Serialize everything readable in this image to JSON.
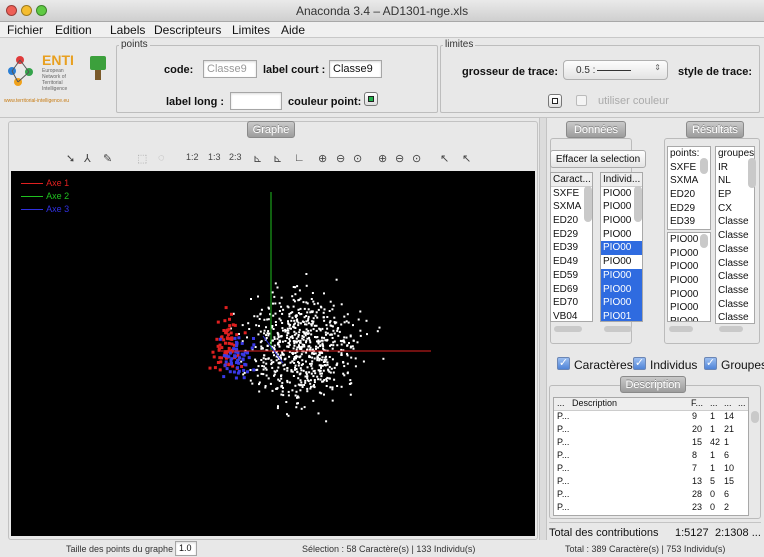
{
  "window": {
    "title": "Anaconda 3.4 – AD1301-nge.xls"
  },
  "menu": [
    "Fichier",
    "Edition",
    "Labels",
    "Descripteurs",
    "Limites",
    "Aide"
  ],
  "logo": {
    "name": "ENTI",
    "lines": [
      "European",
      "Network of",
      "Territorial",
      "Intelligence"
    ],
    "url": "www.territorial-intelligence.eu"
  },
  "points": {
    "legend": "points",
    "code_label": "code:",
    "code_value": "Classe9",
    "short_label": "label court :",
    "short_value": "Classe9",
    "long_label": "label long :",
    "long_value": "",
    "color_label": "couleur point:",
    "color_swatch": "#22b14c"
  },
  "limites": {
    "legend": "limites",
    "thickness_label": "grosseur de trace:",
    "thickness_value": "0.5 :",
    "style_label": "style de trace:",
    "use_color_label": "utiliser couleur"
  },
  "graph": {
    "tab": "Graphe",
    "tools": [
      "1:2",
      "1:3",
      "2:3"
    ],
    "axes": [
      {
        "label": "Axe 1",
        "color": "#e02020"
      },
      {
        "label": "Axe 2",
        "color": "#20c020"
      },
      {
        "label": "Axe 3",
        "color": "#3030e0"
      }
    ]
  },
  "donnees": {
    "tab": "Données",
    "clear_button": "Effacer la selection",
    "caract_header": "Caract...",
    "caract": [
      "SXFE",
      "SXMA",
      "ED20",
      "ED29",
      "ED39",
      "ED49",
      "ED59",
      "ED69",
      "ED70",
      "VB04",
      "VB09"
    ],
    "indiv_header": "Individ...",
    "indiv": [
      "PIO00",
      "PIO00",
      "PIO00",
      "PIO00",
      "PIO00",
      "PIO00",
      "PIO00",
      "PIO00",
      "PIO00",
      "PIO01",
      "PIO01"
    ],
    "indiv_selected": [
      4,
      6,
      7,
      8,
      9
    ]
  },
  "resultats": {
    "tab": "Résultats",
    "points_header": "points:",
    "points": [
      "SXFE",
      "SXMA",
      "ED20",
      "ED29",
      "ED39"
    ],
    "groups_header": "groupes",
    "groups": [
      "IR",
      "NL",
      "EP",
      "CX",
      "Classe",
      "Classe",
      "Classe",
      "Classe",
      "Classe",
      "Classe",
      "Classe",
      "Classe",
      "Classe"
    ],
    "points2": [
      "PIO00",
      "PIO00",
      "PIO00",
      "PIO00",
      "PIO00",
      "PIO00",
      "PIO00"
    ]
  },
  "checks": {
    "caracteres": "Caractères",
    "individus": "Individus",
    "groupes": "Groupes"
  },
  "description": {
    "tab": "Description",
    "headers": [
      "...",
      "Description",
      "F...",
      "...",
      "...",
      "..."
    ],
    "rows": [
      {
        "c0": "P...",
        "f": "9",
        "a": "1",
        "b": "14"
      },
      {
        "c0": "P...",
        "f": "20",
        "a": "1",
        "b": "21"
      },
      {
        "c0": "P...",
        "f": "15",
        "a": "42",
        "b": "1"
      },
      {
        "c0": "P...",
        "f": "8",
        "a": "1",
        "b": "6"
      },
      {
        "c0": "P...",
        "f": "7",
        "a": "1",
        "b": "10"
      },
      {
        "c0": "P...",
        "f": "13",
        "a": "5",
        "b": "15"
      },
      {
        "c0": "P...",
        "f": "28",
        "a": "0",
        "b": "6"
      },
      {
        "c0": "P...",
        "f": "23",
        "a": "0",
        "b": "2"
      }
    ]
  },
  "contributions": {
    "label": "Total des contributions",
    "v1": "1:5127",
    "v2": "2:1308 ..."
  },
  "status": {
    "size_label": "Taille des points du graphe",
    "size_value": "1.0",
    "selection": "Sélection : 58 Caractère(s) | 133 Individu(s)",
    "total": "Total : 389 Caractère(s) | 753 Individu(s)"
  }
}
